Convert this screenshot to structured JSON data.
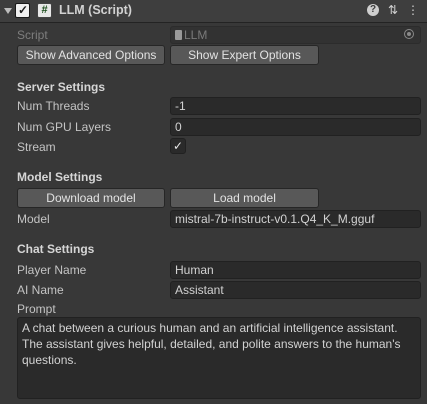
{
  "header": {
    "title": "LLM (Script)",
    "script_icon_glyph": "#",
    "enabled_check": "✓",
    "help_glyph": "?",
    "presets_glyph": "⇅",
    "menu_glyph": "⋮"
  },
  "script": {
    "label": "Script",
    "value": "LLM"
  },
  "options": {
    "advanced_label": "Show Advanced Options",
    "expert_label": "Show Expert Options"
  },
  "server": {
    "section_title": "Server Settings",
    "num_threads_label": "Num Threads",
    "num_threads_value": "-1",
    "num_gpu_layers_label": "Num GPU Layers",
    "num_gpu_layers_value": "0",
    "stream_label": "Stream",
    "stream_checked": true,
    "check_glyph": "✓"
  },
  "model": {
    "section_title": "Model Settings",
    "download_label": "Download model",
    "load_label": "Load model",
    "model_label": "Model",
    "model_value": "mistral-7b-instruct-v0.1.Q4_K_M.gguf"
  },
  "chat": {
    "section_title": "Chat Settings",
    "player_name_label": "Player Name",
    "player_name_value": "Human",
    "ai_name_label": "AI Name",
    "ai_name_value": "Assistant",
    "prompt_label": "Prompt",
    "prompt_value": "A chat between a curious human and an artificial intelligence assistant. The assistant gives helpful, detailed, and polite answers to the human's questions."
  },
  "colors": {
    "background": "#383838",
    "field_background": "#2a2a2a",
    "button_background": "#585858"
  }
}
